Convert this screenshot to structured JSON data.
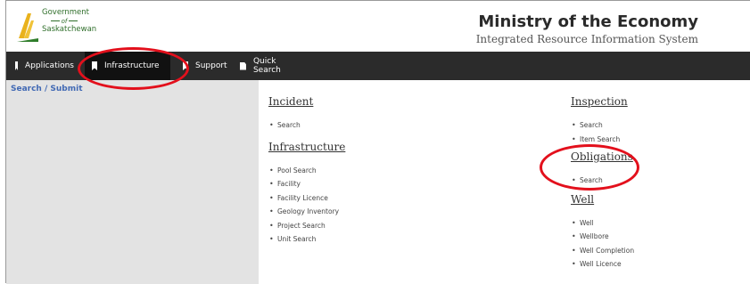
{
  "header": {
    "logo_line1": "Government",
    "logo_line2": "of",
    "logo_line3": "Saskatchewan",
    "title": "Ministry of the Economy",
    "subtitle": "Integrated Resource Information System"
  },
  "nav": {
    "items": [
      {
        "label": "Applications"
      },
      {
        "label": "Infrastructure"
      },
      {
        "label": "Support"
      },
      {
        "label": "Quick Search"
      }
    ]
  },
  "left_panel": {
    "title": "Search / Submit"
  },
  "sections": {
    "incident": {
      "title": "Incident",
      "links": [
        "Search"
      ]
    },
    "infrastructure": {
      "title": "Infrastructure",
      "links": [
        "Pool Search",
        "Facility",
        "Facility Licence",
        "Geology Inventory",
        "Project Search",
        "Unit Search"
      ]
    },
    "inspection": {
      "title": "Inspection",
      "links": [
        "Search",
        "Item Search"
      ]
    },
    "obligations": {
      "title": "Obligations",
      "links": [
        "Search"
      ]
    },
    "well": {
      "title": "Well",
      "links": [
        "Well",
        "Wellbore",
        "Well Completion",
        "Well Licence"
      ]
    }
  },
  "colors": {
    "nav_bg": "#2b2b2b",
    "annotation": "#e3101c",
    "panel_bg": "#e3e3e3",
    "link_title": "#4169b4"
  }
}
